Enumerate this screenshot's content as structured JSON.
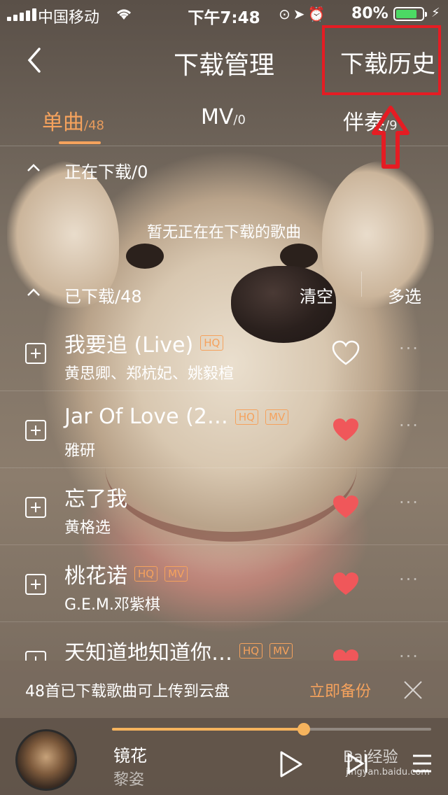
{
  "status_bar": {
    "carrier": "中国移动",
    "time": "下午7:48",
    "battery": "80%",
    "battery_level": 0.8
  },
  "nav": {
    "title": "下载管理",
    "history": "下载历史"
  },
  "tabs": [
    {
      "label": "单曲",
      "count": "/48",
      "active": true
    },
    {
      "label": "MV",
      "count": "/0",
      "active": false
    },
    {
      "label": "伴奏",
      "count": "/9",
      "active": false
    }
  ],
  "downloading": {
    "label": "正在下载/0",
    "empty": "暂无正在在下载的歌曲"
  },
  "downloaded": {
    "label": "已下载/48",
    "clear": "清空",
    "multi": "多选"
  },
  "songs": [
    {
      "title": "我要追 (Live)",
      "badges": [
        "HQ"
      ],
      "artist": "黄思卿、郑杭妃、姚毅楦",
      "liked": false
    },
    {
      "title": "Jar Of Love (2…",
      "badges": [
        "HQ",
        "MV"
      ],
      "artist": "雅研",
      "liked": true
    },
    {
      "title": "忘了我",
      "badges": [],
      "artist": "黄格选",
      "liked": true
    },
    {
      "title": "桃花诺",
      "badges": [
        "HQ",
        "MV"
      ],
      "artist": "G.E.M.邓紫棋",
      "liked": true
    },
    {
      "title": "天知道地知道你…",
      "badges": [
        "HQ",
        "MV"
      ],
      "artist": "",
      "liked": true
    }
  ],
  "banner": {
    "message": "48首已下载歌曲可上传到云盘",
    "action": "立即备份"
  },
  "player": {
    "track": "镜花",
    "artist": "黎姿",
    "progress": 0.6
  },
  "watermark": {
    "text": "Bai经验",
    "url": "jingyan.baidu.com"
  },
  "colors": {
    "accent": "#f5a25d",
    "heart": "#f0575a",
    "highlight": "#e51c23"
  }
}
